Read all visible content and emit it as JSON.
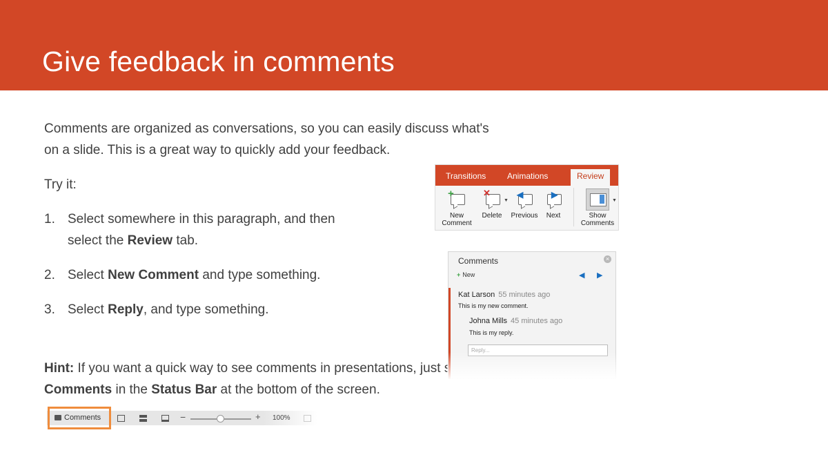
{
  "slide": {
    "title": "Give feedback in comments",
    "intro_line1": "Comments are organized as conversations, so you can easily discuss what's",
    "intro_line2": "on a slide. This is a great way to quickly add your feedback.",
    "try_it": "Try it:",
    "steps": [
      {
        "num": "1.",
        "line1": "Select somewhere in this paragraph, and then",
        "line2_pre": "select the ",
        "line2_bold": "Review",
        "line2_post": " tab."
      },
      {
        "num": "2.",
        "pre": "Select ",
        "bold": "New Comment",
        "post": " and type something."
      },
      {
        "num": "3.",
        "pre": "Select ",
        "bold": "Reply",
        "post": ", and type something."
      }
    ],
    "hint": {
      "label": "Hint:",
      "line1": " If you want a quick way to see comments in presentations, just select",
      "bold1": "Comments",
      "mid": " in the ",
      "bold2": "Status Bar",
      "end": " at the bottom of the screen."
    }
  },
  "ribbon": {
    "tabs": [
      "Transitions",
      "Animations",
      "Review"
    ],
    "active_tab": "Review",
    "buttons": [
      {
        "label1": "New",
        "label2": "Comment",
        "icon": "new-comment-icon"
      },
      {
        "label1": "Delete",
        "label2": "",
        "icon": "delete-comment-icon"
      },
      {
        "label1": "Previous",
        "label2": "",
        "icon": "previous-comment-icon"
      },
      {
        "label1": "Next",
        "label2": "",
        "icon": "next-comment-icon"
      },
      {
        "label1": "Show",
        "label2": "Comments",
        "icon": "show-comments-icon"
      }
    ]
  },
  "comments_pane": {
    "title": "Comments",
    "new_label": "New",
    "comments": [
      {
        "author": "Kat Larson",
        "time": "55 minutes ago",
        "text": "This is my new comment."
      },
      {
        "author": "Johna Mills",
        "time": "45 minutes ago",
        "text": "This is my reply."
      }
    ],
    "reply_placeholder": "Reply..."
  },
  "status_bar": {
    "comments_label": "Comments",
    "zoom": "100%"
  },
  "colors": {
    "accent": "#d24726",
    "highlight": "#ef8c3c"
  }
}
